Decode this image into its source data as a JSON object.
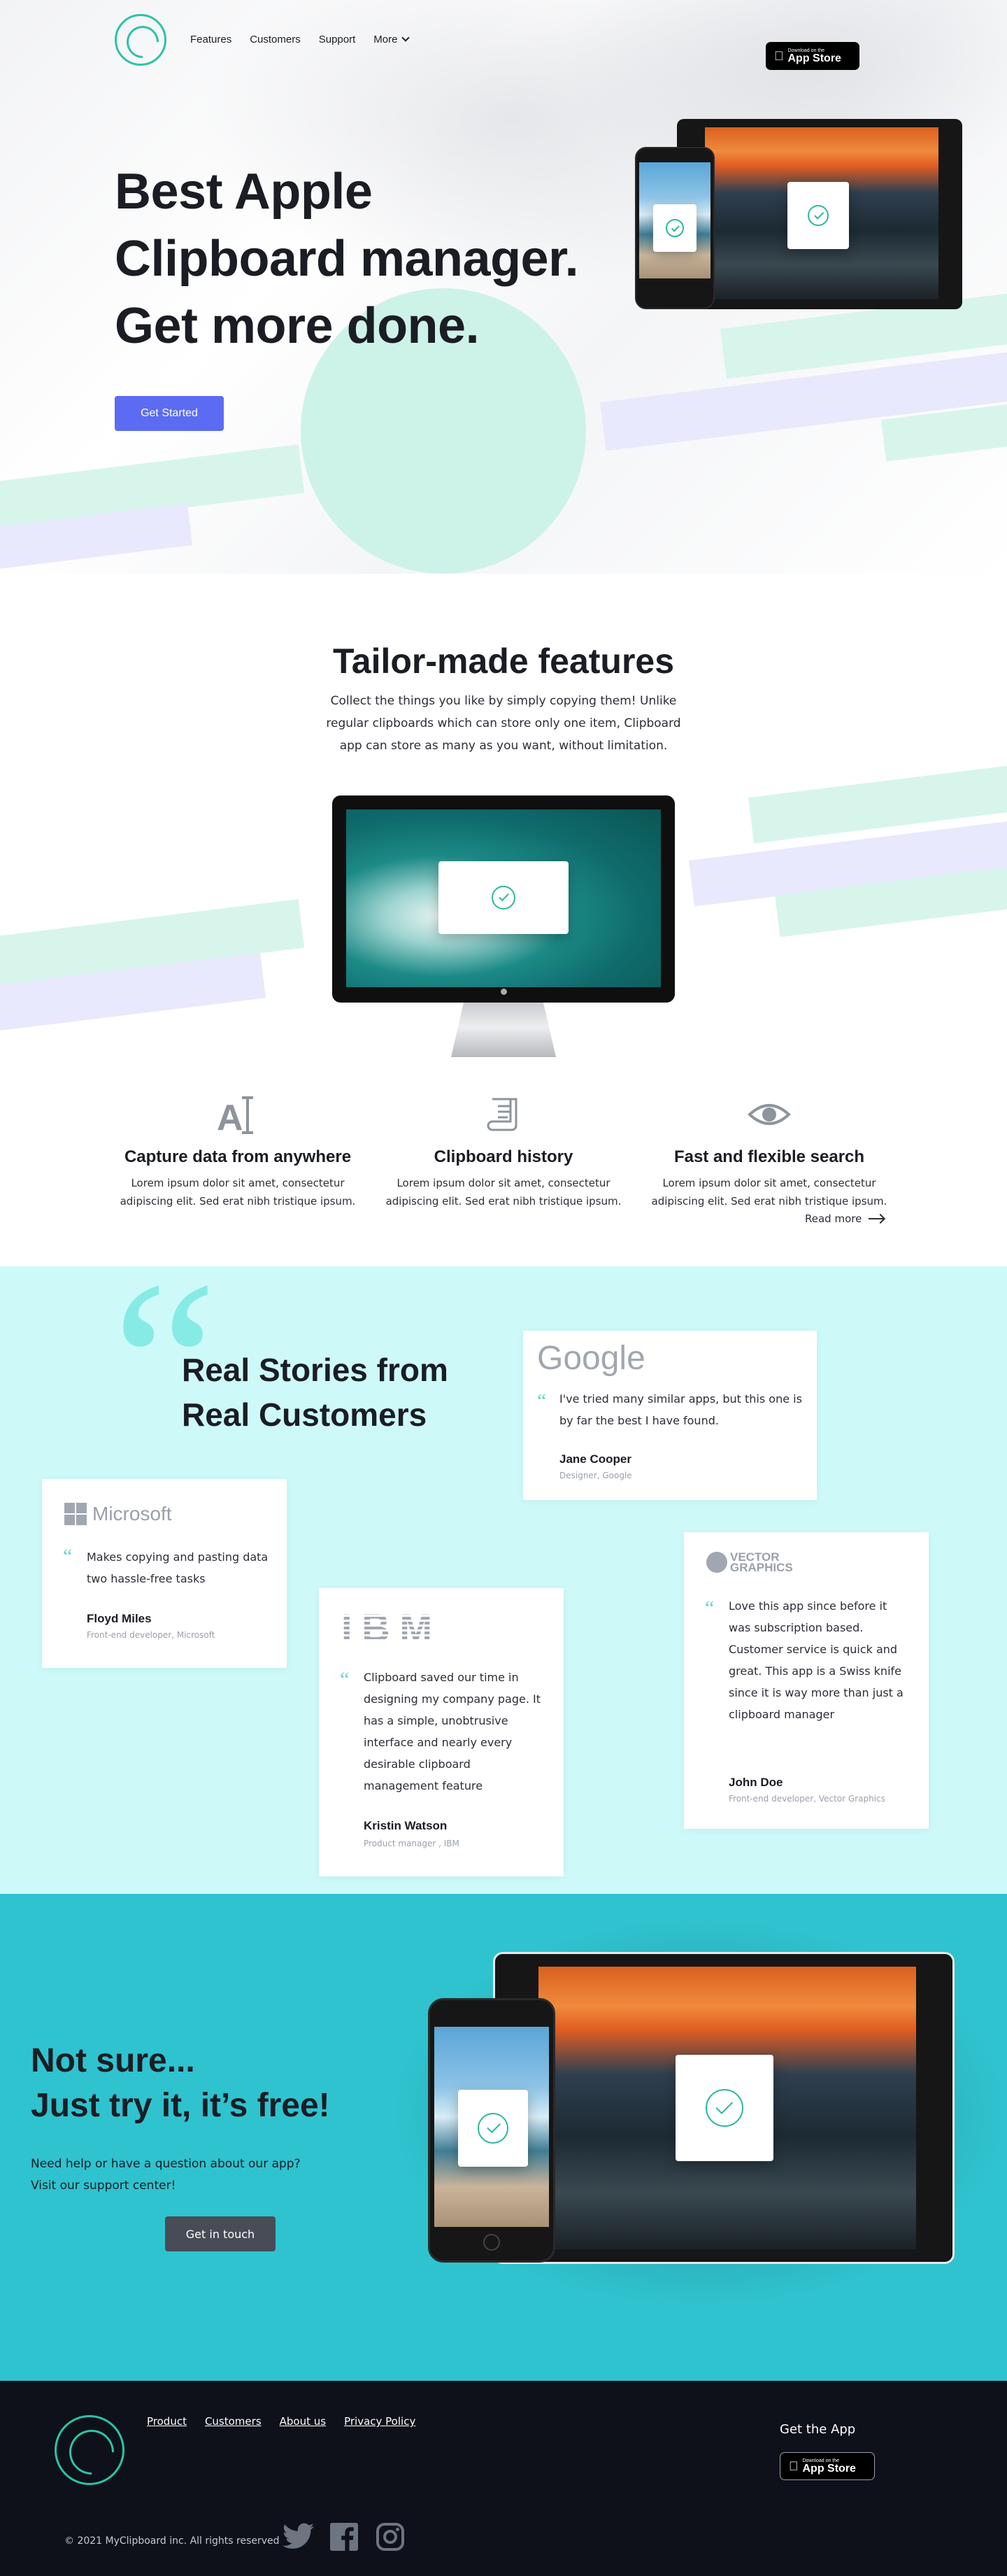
{
  "header": {
    "nav": [
      "Features",
      "Customers",
      "Support",
      "More"
    ],
    "app_store": {
      "small": "Download on the",
      "big": "App Store"
    }
  },
  "hero": {
    "title_lines": [
      "Best Apple",
      "Clipboard manager.",
      "Get more done."
    ],
    "cta": "Get Started"
  },
  "features": {
    "title": "Tailor-made features",
    "text": "Collect the things you like by simply copying them! Unlike regular clipboards which can store only one item, Clipboard app can store as many as you want, without limitation.",
    "items": [
      {
        "icon": "text-cursor-icon",
        "title": "Capture data from anywhere",
        "text": "Lorem ipsum dolor sit amet, consectetur adipiscing elit. Sed erat nibh tristique ipsum."
      },
      {
        "icon": "scroll-icon",
        "title": "Clipboard history",
        "text": "Lorem ipsum dolor sit amet, consectetur adipiscing elit. Sed erat nibh tristique ipsum."
      },
      {
        "icon": "eye-icon",
        "title": "Fast and flexible search",
        "text": "Lorem ipsum dolor sit amet, consectetur adipiscing elit. Sed erat nibh tristique ipsum."
      }
    ],
    "read_more": "Read more"
  },
  "testimonials": {
    "title_lines": [
      "Real Stories from",
      "Real Customers"
    ],
    "cards": [
      {
        "brand": "Google",
        "quote": "I've tried many similar apps, but this one is by far the best I have found.",
        "name": "Jane Cooper",
        "role": "Designer, Google"
      },
      {
        "brand": "Microsoft",
        "quote": "Makes copying and pasting data two hassle-free tasks",
        "name": "Floyd Miles",
        "role": "Front-end developer, Microsoft"
      },
      {
        "brand": "IBM",
        "quote": "Clipboard saved our time in designing my company page. It has a simple, unobtrusive interface and nearly every desirable clipboard management feature",
        "name": "Kristin Watson",
        "role": "Product manager , IBM"
      },
      {
        "brand": "VECTOR GRAPHICS",
        "quote": "Love this app since before it was subscription based. Customer service is quick and great. This app is a Swiss knife since it is way more than just a clipboard manager",
        "name": "John Doe",
        "role": "Front-end developer, Vector Graphics"
      }
    ]
  },
  "cta": {
    "title_lines": [
      "Not sure...",
      "Just try it, it’s free!"
    ],
    "text_lines": [
      "Need help or have a question about our app?",
      "Visit our support center!"
    ],
    "button": "Get in touch"
  },
  "footer": {
    "links": [
      "Product",
      "Customers",
      "About us",
      "Privacy Policy"
    ],
    "get_app": "Get the App",
    "copyright": "© 2021  MyClipboard inc. All rights reserved",
    "social": [
      "twitter-icon",
      "facebook-icon",
      "instagram-icon"
    ]
  },
  "colors": {
    "accent": "#5c6cf2",
    "brand": "#2cc3a6",
    "testimonials_bg": "#cdfaf8",
    "cta_bg": "#2fc3cf",
    "footer_bg": "#0e111a"
  }
}
